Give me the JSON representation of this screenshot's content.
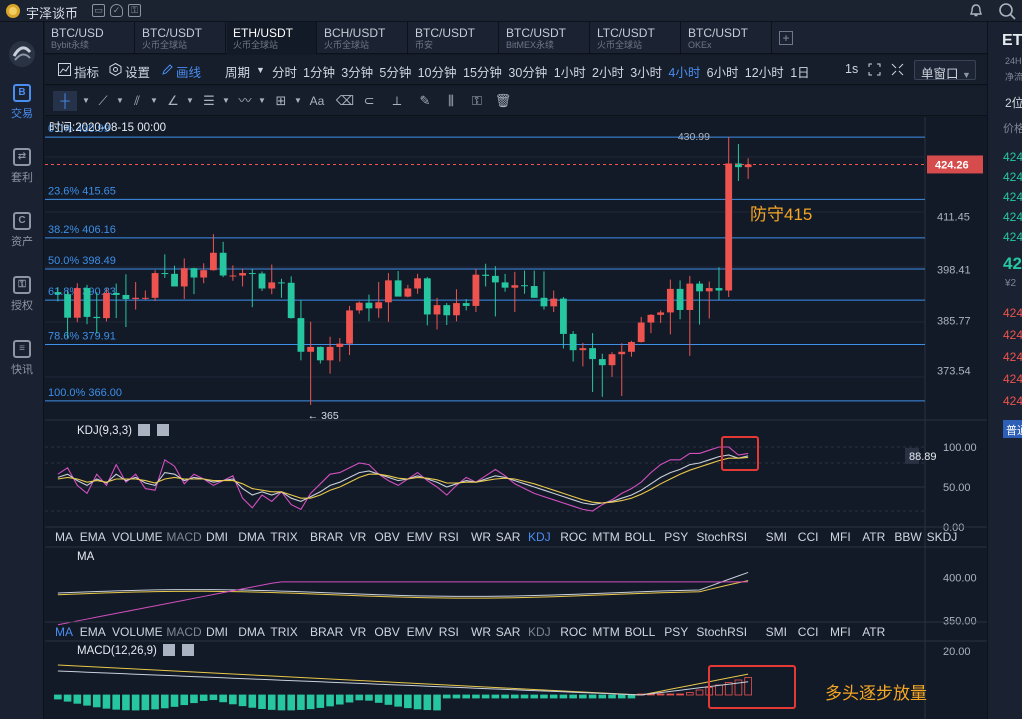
{
  "app": {
    "title": "宇泽谈币"
  },
  "nav": [
    {
      "label": "交易",
      "glyph": "B",
      "active": true
    },
    {
      "label": "套利",
      "glyph": "⇄",
      "active": false
    },
    {
      "label": "资产",
      "glyph": "C",
      "active": false
    },
    {
      "label": "授权",
      "glyph": "⚿",
      "active": false
    },
    {
      "label": "快讯",
      "glyph": "≡",
      "active": false
    }
  ],
  "tabs": [
    {
      "name": "BTC/USD",
      "sub": "Bybit永续",
      "active": false
    },
    {
      "name": "BTC/USDT",
      "sub": "火币全球站",
      "active": false
    },
    {
      "name": "ETH/USDT",
      "sub": "火币全球站",
      "active": true
    },
    {
      "name": "BCH/USDT",
      "sub": "火币全球站",
      "active": false
    },
    {
      "name": "BTC/USDT",
      "sub": "币安",
      "active": false
    },
    {
      "name": "BTC/USDT",
      "sub": "BitMEX永续",
      "active": false
    },
    {
      "name": "LTC/USDT",
      "sub": "火币全球站",
      "active": false
    },
    {
      "name": "BTC/USDT",
      "sub": "OKEx",
      "active": false
    }
  ],
  "toolbar": {
    "indicator_label": "指标",
    "settings_label": "设置",
    "draw_label": "画线",
    "period_label": "周期",
    "periods": [
      "分时",
      "1分钟",
      "3分钟",
      "5分钟",
      "10分钟",
      "15分钟",
      "30分钟",
      "1小时",
      "2小时",
      "3小时",
      "4小时",
      "6小时",
      "12小时",
      "1日"
    ],
    "active_period": "4小时",
    "seconds_label": "1s",
    "window_label": "单窗口"
  },
  "chart": {
    "time_label": "时间:2020-08-15 00:00",
    "fib_levels": [
      {
        "label": "0.0% 430.99",
        "price": 430.99
      },
      {
        "label": "23.6% 415.65",
        "price": 415.65
      },
      {
        "label": "38.2% 406.16",
        "price": 406.16
      },
      {
        "label": "50.0% 398.49",
        "price": 398.49
      },
      {
        "label": "61.8% 390.83",
        "price": 390.83
      },
      {
        "label": "78.6% 379.91",
        "price": 379.91
      },
      {
        "label": "100.0% 366.00",
        "price": 366.0
      }
    ],
    "price_axis": [
      "411.45",
      "398.41",
      "385.77",
      "373.54"
    ],
    "current_price": "424.26",
    "high_label": "430.99",
    "low_label": "← 365",
    "annotation_defend": "防守415",
    "annotation_bull": "多头逐步放量"
  },
  "chart_data": {
    "type": "candlestick",
    "symbol": "ETH/USDT",
    "exchange": "火币全球站",
    "interval": "4小时",
    "x_label": "时间:2020-08-15 00:00",
    "candles": [
      [
        392.8,
        394.0,
        390.5,
        392.3
      ],
      [
        392.3,
        393.2,
        381.5,
        386.5
      ],
      [
        386.5,
        395.0,
        385.4,
        393.8
      ],
      [
        393.8,
        394.6,
        384.9,
        386.7
      ],
      [
        386.7,
        392.8,
        382.6,
        386.4
      ],
      [
        386.4,
        393.7,
        385.6,
        392.6
      ],
      [
        392.6,
        394.9,
        386.4,
        392.1
      ],
      [
        392.1,
        397.2,
        384.2,
        391.1
      ],
      [
        391.1,
        395.3,
        388.5,
        391.4
      ],
      [
        391.4,
        393.2,
        390.9,
        391.4
      ],
      [
        391.4,
        398.2,
        390.6,
        397.5
      ],
      [
        397.5,
        402.1,
        396.3,
        397.3
      ],
      [
        397.3,
        399.3,
        394.3,
        394.2
      ],
      [
        394.2,
        401.1,
        391.1,
        398.7
      ],
      [
        398.7,
        398.8,
        392.3,
        396.4
      ],
      [
        396.4,
        399.9,
        395.0,
        398.2
      ],
      [
        398.2,
        407.1,
        398.1,
        402.5
      ],
      [
        402.5,
        405.2,
        396.5,
        396.9
      ],
      [
        396.9,
        399.4,
        395.6,
        396.9
      ],
      [
        396.9,
        398.6,
        394.2,
        397.5
      ],
      [
        397.5,
        398.5,
        389.1,
        397.4
      ],
      [
        397.4,
        397.9,
        393.1,
        393.7
      ],
      [
        393.7,
        399.6,
        392.3,
        395.2
      ],
      [
        395.2,
        396.1,
        391.4,
        395.1
      ],
      [
        395.1,
        396.7,
        386.3,
        386.4
      ],
      [
        386.4,
        390.8,
        376.0,
        378.1
      ],
      [
        378.1,
        385.5,
        365.0,
        379.3
      ],
      [
        379.3,
        379.4,
        375.2,
        376.0
      ],
      [
        376.0,
        381.8,
        372.7,
        379.3
      ],
      [
        379.3,
        381.5,
        375.7,
        380.1
      ],
      [
        380.1,
        389.4,
        377.3,
        388.3
      ],
      [
        388.3,
        390.5,
        387.5,
        390.2
      ],
      [
        390.2,
        392.2,
        385.6,
        388.8
      ],
      [
        388.8,
        395.3,
        386.5,
        390.3
      ],
      [
        390.3,
        397.5,
        385.5,
        395.7
      ],
      [
        395.7,
        398.0,
        391.9,
        391.7
      ],
      [
        391.7,
        394.6,
        391.5,
        393.7
      ],
      [
        393.7,
        397.3,
        392.4,
        396.2
      ],
      [
        396.2,
        396.5,
        384.6,
        387.3
      ],
      [
        387.3,
        391.4,
        383.6,
        389.6
      ],
      [
        389.6,
        390.1,
        384.7,
        387.1
      ],
      [
        387.1,
        393.5,
        385.6,
        390.1
      ],
      [
        390.1,
        391.1,
        388.3,
        389.4
      ],
      [
        389.4,
        398.5,
        387.9,
        397.1
      ],
      [
        397.1,
        399.8,
        394.2,
        396.8
      ],
      [
        396.8,
        399.2,
        386.8,
        395.2
      ],
      [
        395.2,
        397.3,
        392.9,
        393.9
      ],
      [
        393.9,
        397.8,
        387.9,
        394.5
      ],
      [
        394.5,
        398.1,
        392.4,
        394.3
      ],
      [
        394.3,
        398.1,
        392.8,
        391.4
      ],
      [
        391.4,
        397.9,
        388.5,
        389.3
      ],
      [
        389.3,
        393.2,
        387.9,
        391.2
      ],
      [
        391.2,
        391.6,
        378.9,
        382.5
      ],
      [
        382.5,
        383.2,
        375.7,
        378.5
      ],
      [
        378.5,
        380.3,
        374.5,
        379.0
      ],
      [
        379.0,
        382.7,
        368.2,
        376.3
      ],
      [
        376.3,
        377.6,
        367.0,
        374.8
      ],
      [
        374.8,
        378.0,
        371.9,
        377.5
      ],
      [
        377.5,
        380.2,
        367.2,
        378.1
      ],
      [
        378.1,
        380.8,
        376.9,
        380.5
      ],
      [
        380.5,
        386.7,
        380.4,
        385.3
      ],
      [
        385.3,
        387.4,
        382.7,
        387.2
      ],
      [
        387.2,
        388.3,
        385.2,
        387.8
      ],
      [
        387.8,
        395.9,
        382.4,
        393.6
      ],
      [
        393.6,
        395.7,
        386.1,
        388.4
      ],
      [
        388.4,
        396.8,
        377.1,
        394.9
      ],
      [
        394.9,
        395.5,
        384.8,
        393.0
      ],
      [
        393.0,
        395.4,
        386.3,
        393.8
      ],
      [
        393.8,
        398.9,
        390.9,
        393.2
      ],
      [
        393.2,
        430.99,
        391.6,
        424.5
      ],
      [
        424.5,
        429.3,
        420.2,
        423.6
      ],
      [
        423.6,
        425.8,
        420.7,
        424.26
      ]
    ],
    "fibonacci": [
      {
        "level": "0.0%",
        "price": 430.99
      },
      {
        "level": "23.6%",
        "price": 415.65
      },
      {
        "level": "38.2%",
        "price": 406.16
      },
      {
        "level": "50.0%",
        "price": 398.49
      },
      {
        "level": "61.8%",
        "price": 390.83
      },
      {
        "level": "78.6%",
        "price": 379.91
      },
      {
        "level": "100.0%",
        "price": 366.0
      }
    ],
    "price_ylim": [
      364,
      433
    ],
    "last_price": 424.26,
    "kdj": {
      "title": "KDJ(9,3,3)",
      "axis": [
        "100.00",
        "50.00",
        "0.00"
      ],
      "current_value": "88.89",
      "K": [
        62,
        66,
        58,
        52,
        60,
        55,
        66,
        58,
        62,
        55,
        52,
        68,
        66,
        58,
        62,
        60,
        56,
        58,
        60,
        48,
        40,
        44,
        40,
        44,
        36,
        32,
        38,
        44,
        52,
        56,
        62,
        68,
        70,
        66,
        62,
        58,
        60,
        64,
        60,
        56,
        50,
        54,
        58,
        56,
        60,
        64,
        62,
        58,
        54,
        50,
        46,
        42,
        38,
        34,
        30,
        28,
        30,
        32,
        36,
        40,
        46,
        54,
        62,
        68,
        72,
        78,
        80,
        84,
        88,
        90,
        86,
        88.89
      ],
      "D": [
        60,
        62,
        60,
        56,
        58,
        56,
        60,
        60,
        60,
        58,
        55,
        60,
        62,
        60,
        60,
        60,
        58,
        58,
        58,
        54,
        48,
        46,
        44,
        44,
        40,
        36,
        36,
        40,
        46,
        50,
        56,
        62,
        66,
        66,
        64,
        61,
        60,
        62,
        61,
        59,
        55,
        55,
        56,
        56,
        58,
        60,
        61,
        60,
        57,
        54,
        50,
        46,
        42,
        38,
        34,
        31,
        30,
        31,
        33,
        36,
        41,
        47,
        54,
        60,
        66,
        71,
        75,
        79,
        83,
        86,
        86,
        87
      ],
      "J": [
        66,
        74,
        52,
        42,
        66,
        52,
        78,
        56,
        66,
        48,
        46,
        84,
        76,
        54,
        66,
        60,
        52,
        58,
        64,
        36,
        24,
        40,
        32,
        44,
        28,
        22,
        42,
        54,
        66,
        68,
        74,
        80,
        78,
        66,
        58,
        52,
        60,
        68,
        58,
        50,
        40,
        52,
        62,
        56,
        64,
        72,
        64,
        54,
        48,
        42,
        38,
        34,
        30,
        26,
        22,
        20,
        28,
        34,
        42,
        48,
        56,
        68,
        78,
        84,
        84,
        92,
        92,
        96,
        100,
        100,
        90,
        92
      ]
    },
    "ma": {
      "title": "MA",
      "axis": [
        "400.00",
        "350.00"
      ]
    },
    "macd": {
      "title": "MACD(12,26,9)",
      "axis": [
        "20.00"
      ]
    }
  },
  "indicator_row_1": [
    "MA",
    "EMA",
    "VOLUME",
    "MACD",
    "DMI",
    "DMA",
    "TRIX",
    "BRAR",
    "VR",
    "OBV",
    "EMV",
    "RSI",
    "WR",
    "SAR",
    "KDJ",
    "ROC",
    "MTM",
    "BOLL",
    "PSY",
    "StochRSI",
    "SMI",
    "CCI",
    "MFI",
    "ATR",
    "BBW",
    "SKDJ"
  ],
  "indicator_row_2": [
    "MA",
    "EMA",
    "VOLUME",
    "MACD",
    "DMI",
    "DMA",
    "TRIX",
    "BRAR",
    "VR",
    "OBV",
    "EMV",
    "RSI",
    "WR",
    "SAR",
    "KDJ",
    "ROC",
    "MTM",
    "BOLL",
    "PSY",
    "StochRSI",
    "SMI",
    "CCI",
    "MFI",
    "ATR"
  ],
  "right_panel": {
    "symbol": "ET",
    "h24": "24H",
    "net": "净流",
    "depth": "2位",
    "price_col": "价格",
    "asks": [
      "424",
      "424",
      "424",
      "424",
      "424"
    ],
    "last": "42",
    "last_cny": "¥2",
    "bids": [
      "424",
      "424",
      "424",
      "424",
      "424"
    ],
    "mode": "普通"
  },
  "colors": {
    "up": "#ef5350",
    "down": "#26c6a0",
    "accent": "#4a8ef0",
    "fib": "#3d8fe8",
    "annotation": "#f5a623"
  }
}
